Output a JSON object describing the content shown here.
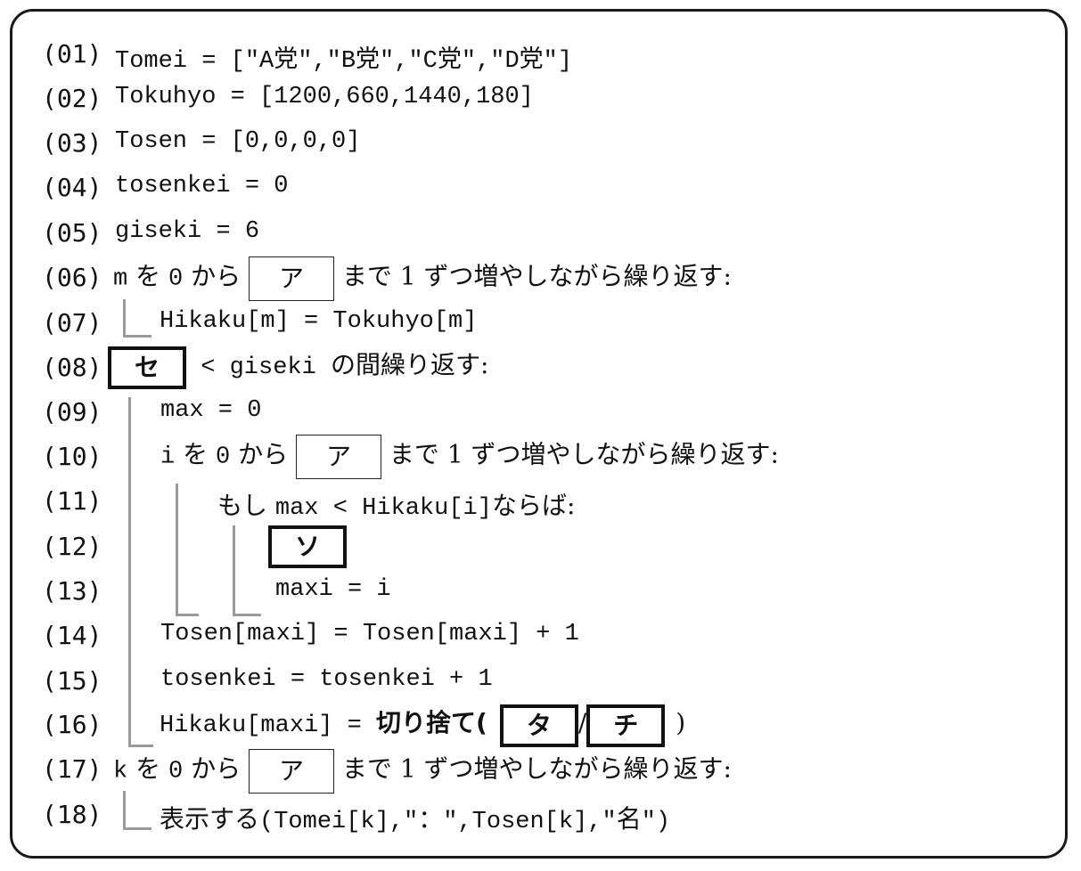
{
  "line_numbers": [
    "(01)",
    "(02)",
    "(03)",
    "(04)",
    "(05)",
    "(06)",
    "(07)",
    "(08)",
    "(09)",
    "(10)",
    "(11)",
    "(12)",
    "(13)",
    "(14)",
    "(15)",
    "(16)",
    "(17)",
    "(18)"
  ],
  "lines": {
    "l01": "Tomei = [\"A党\",\"B党\",\"C党\",\"D党\"]",
    "l02": "Tokuhyo = [1200,660,1440,180]",
    "l03": "Tosen = [0,0,0,0]",
    "l04": "tosenkei = 0",
    "l05": "giseki = 6",
    "l06_pre_var": "m",
    "l06_pre_jp": " を ",
    "l06_zero": "0",
    "l06_from": " から ",
    "l06_box": "ア",
    "l06_post": " まで 1 ずつ増やしながら繰り返す:",
    "l07": "Hikaku[m] = Tokuhyo[m]",
    "l08_box": "セ",
    "l08_mid": " < giseki ",
    "l08_post": "の間繰り返す:",
    "l09": "max = 0",
    "l10_var": "i",
    "l10_jp": " を ",
    "l10_zero": "0",
    "l10_from": " から ",
    "l10_box": "ア",
    "l10_post": " まで 1 ずつ増やしながら繰り返す:",
    "l11_pre": "もし ",
    "l11_code": "max < Hikaku[i]",
    "l11_post": "ならば:",
    "l12_box": "ソ",
    "l13": "maxi = i",
    "l14": "Tosen[maxi] = Tosen[maxi] + 1",
    "l15": "tosenkei = tosenkei + 1",
    "l16_pre": "Hikaku[maxi] = ",
    "l16_fn": "切り捨て(",
    "l16_box1": "タ",
    "l16_slash": "/",
    "l16_box2": "チ",
    "l16_close": ")",
    "l17_var": "k",
    "l17_jp": " を ",
    "l17_zero": "0",
    "l17_from": " から ",
    "l17_box": "ア",
    "l17_post": " まで 1 ずつ増やしながら繰り返す:",
    "l18_fn": "表示する",
    "l18_args_a": "(Tomei[k],\"",
    "l18_colon": "：",
    "l18_args_b": "\",Tosen[k],\"",
    "l18_mei": "名",
    "l18_args_c": "\")"
  }
}
